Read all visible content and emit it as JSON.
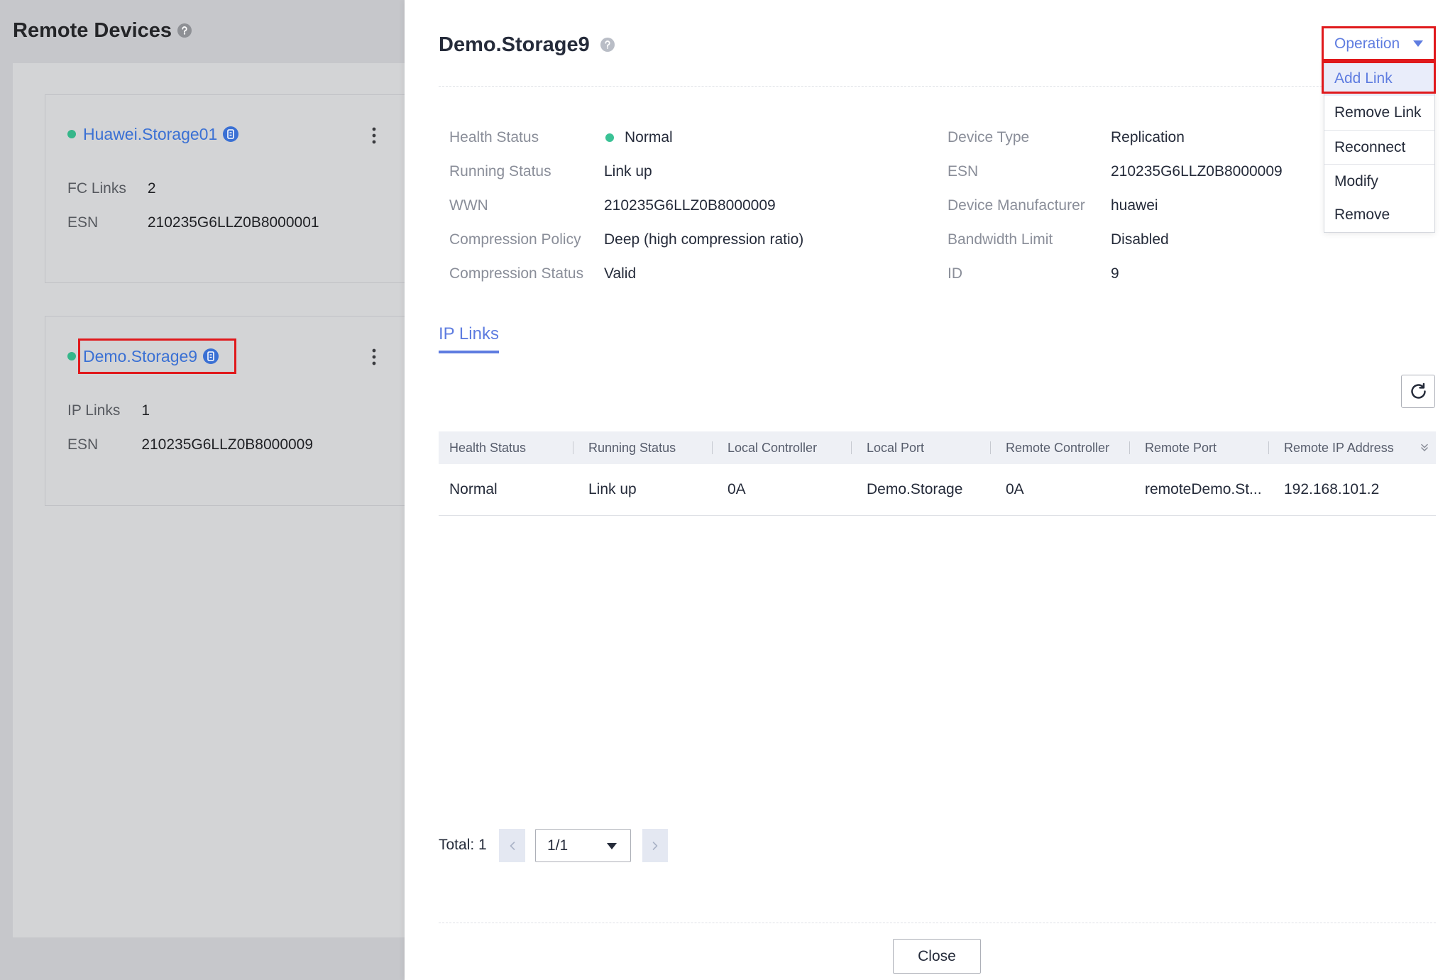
{
  "left_page": {
    "title": "Remote Devices",
    "devices": [
      {
        "name": "Huawei.Storage01",
        "fields": [
          {
            "label": "FC Links",
            "value": "2"
          },
          {
            "label": "ESN",
            "value": "210235G6LLZ0B8000001"
          }
        ]
      },
      {
        "name": "Demo.Storage9",
        "fields": [
          {
            "label": "IP Links",
            "value": "1"
          },
          {
            "label": "ESN",
            "value": "210235G6LLZ0B8000009"
          }
        ]
      }
    ]
  },
  "drawer": {
    "title": "Demo.Storage9",
    "operation": {
      "label": "Operation",
      "menu": [
        "Add Link",
        "Remove Link",
        "Reconnect",
        "Modify",
        "Remove"
      ],
      "active_index": 0
    },
    "details_left": [
      {
        "label": "Health Status",
        "value": "Normal"
      },
      {
        "label": "Running Status",
        "value": "Link up"
      },
      {
        "label": "WWN",
        "value": "210235G6LLZ0B8000009"
      },
      {
        "label": "Compression Policy",
        "value": "Deep (high compression ratio)"
      },
      {
        "label": "Compression Status",
        "value": "Valid"
      }
    ],
    "details_right": [
      {
        "label": "Device Type",
        "value": "Replication"
      },
      {
        "label": "ESN",
        "value": "210235G6LLZ0B8000009"
      },
      {
        "label": "Device Manufacturer",
        "value": "huawei"
      },
      {
        "label": "Bandwidth Limit",
        "value": "Disabled"
      },
      {
        "label": "ID",
        "value": "9"
      }
    ],
    "tabs": [
      {
        "label": "IP Links",
        "active": true
      }
    ],
    "table": {
      "columns": [
        "Health Status",
        "Running Status",
        "Local Controller",
        "Local Port",
        "Remote Controller",
        "Remote Port",
        "Remote IP Address"
      ],
      "rows": [
        [
          "Normal",
          "Link up",
          "0A",
          "Demo.Storage",
          "0A",
          "remoteDemo.St...",
          "192.168.101.2"
        ]
      ]
    },
    "pagination": {
      "total_label": "Total:",
      "total": "1",
      "page": "1/1"
    },
    "close_label": "Close"
  },
  "colors": {
    "accent": "#5e7ce0",
    "link": "#3a70d4",
    "status_normal": "#3ac295",
    "highlight_box": "#e0191c",
    "table_header_bg": "#eef0f5",
    "menu_active_bg": "#e9edfa"
  },
  "icons": {
    "help": "help-icon",
    "device_info": "storage-info-icon",
    "more": "kebab-menu-icon",
    "dropdown": "caret-down-icon",
    "refresh": "refresh-icon",
    "column_settings": "expand-columns-icon",
    "prev": "chevron-left-icon",
    "next": "chevron-right-icon"
  }
}
